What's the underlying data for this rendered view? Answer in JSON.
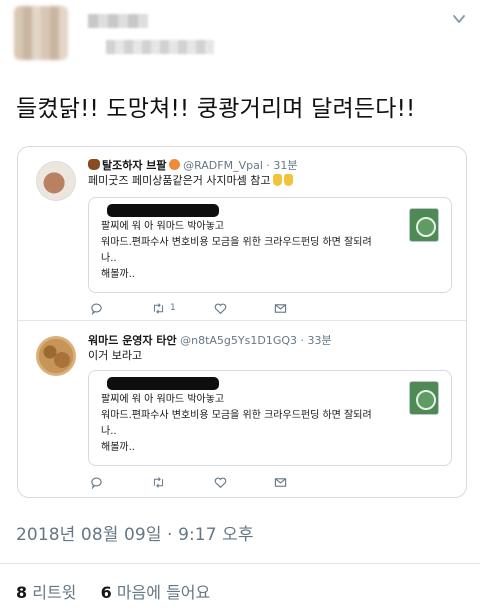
{
  "tweet": {
    "text": "들켰닭!! 도망쳐!! 쿵쾅거리며 달려든다!!",
    "timestamp": "2018년 08월 09일 · 9:17 오후",
    "retweets_count": "8",
    "retweets_label": "리트윗",
    "likes_count": "6",
    "likes_label": "마음에 들어요",
    "menu_icon": "chevron-down-icon"
  },
  "quotes": [
    {
      "name": "탈조하자 브팔",
      "handle": "@RADFM_Vpal · 31분",
      "text": "페미굿즈 페미상품같은거 사지마셈 참고",
      "inner": {
        "line1": "팔찌에 워 아 워마드 박아놓고",
        "line2": "워마드.편파수사 변호비용 모금을 위한 크라우드펀딩 하면 잘되려",
        "line3": "나..",
        "line4": "해볼까.."
      },
      "retweet_count": "1"
    },
    {
      "name": "워마드 운영자 타안",
      "handle": "@n8tA5g5Ys1D1GQ3 · 33분",
      "text": "이거 보라고",
      "inner": {
        "line1": "팔찌에 워 아 워마드 박아놓고",
        "line2": "워마드.편파수사 변호비용 모금을 위한 크라우드펀딩 하면 잘되려",
        "line3": "나..",
        "line4": "해볼까.."
      },
      "retweet_count": ""
    }
  ],
  "icons": [
    "reply-icon",
    "retweet-icon",
    "like-icon",
    "dm-icon"
  ]
}
